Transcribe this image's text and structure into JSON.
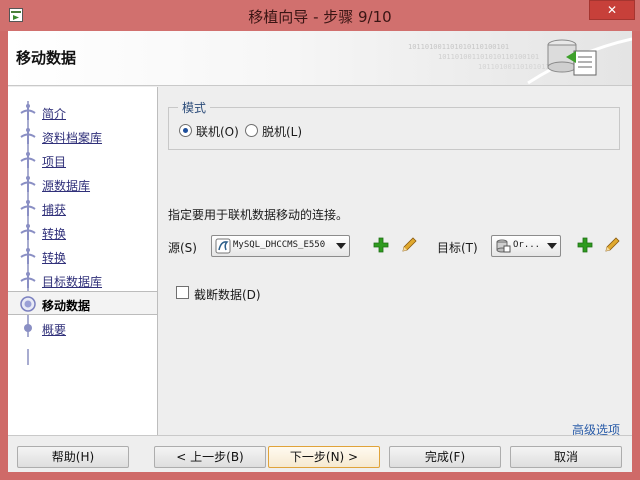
{
  "window": {
    "title": "移植向导 - 步骤 9/10",
    "close_label": "✕"
  },
  "header": {
    "title": "移动数据",
    "art_text": "101101001101010110100101"
  },
  "sidebar": {
    "steps": [
      {
        "label": "简介",
        "state": "done"
      },
      {
        "label": "资料档案库",
        "state": "done"
      },
      {
        "label": "项目",
        "state": "done"
      },
      {
        "label": "源数据库",
        "state": "done"
      },
      {
        "label": "捕获",
        "state": "done"
      },
      {
        "label": "转换",
        "state": "done"
      },
      {
        "label": "转换",
        "state": "done"
      },
      {
        "label": "目标数据库",
        "state": "done"
      },
      {
        "label": "移动数据",
        "state": "current"
      },
      {
        "label": "概要",
        "state": "pending"
      }
    ]
  },
  "mode": {
    "legend": "模式",
    "online_label": "联机(O)",
    "offline_label": "脱机(L)",
    "selected": "online"
  },
  "description": "指定要用于联机数据移动的连接。",
  "source": {
    "label": "源(S)",
    "value": "MySQL_DHCCMS_E550"
  },
  "target": {
    "label": "目标(T)",
    "value": "Or..."
  },
  "truncate": {
    "label": "截断数据(D)",
    "checked": false
  },
  "advanced_link": "高级选项",
  "buttons": {
    "help": "帮助(H)",
    "back": "< 上一步(B)",
    "next": "下一步(N) >",
    "finish": "完成(F)",
    "cancel": "取消"
  },
  "colors": {
    "titlebar": "#d1706e",
    "link": "#30307a",
    "accent_green": "#2e8b1f"
  }
}
